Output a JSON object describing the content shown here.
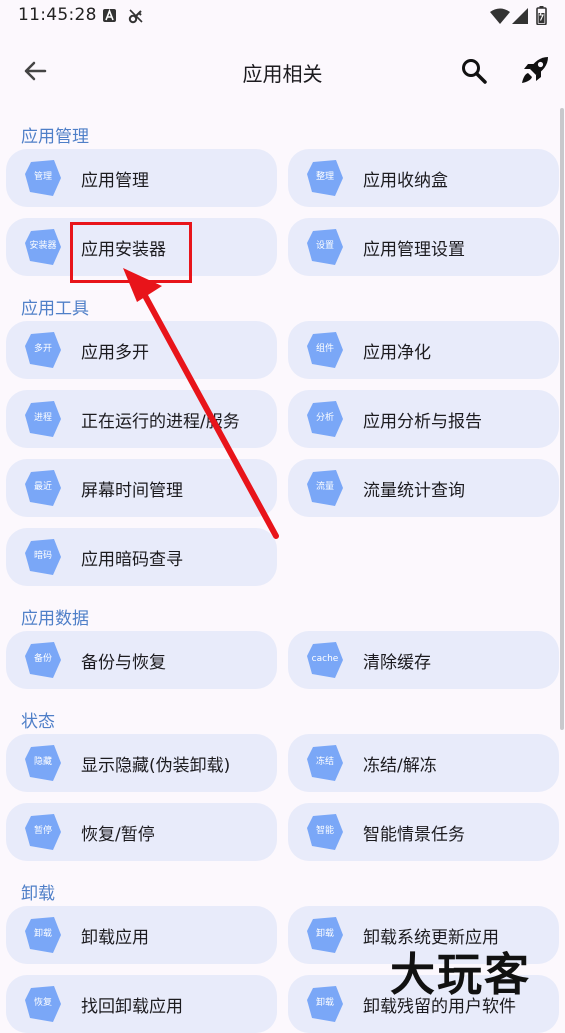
{
  "status_bar": {
    "time": "11:45:28",
    "icons": [
      "a-icon",
      "vpn-key-icon",
      "wifi-icon",
      "signal-icon",
      "battery-icon"
    ]
  },
  "app_bar": {
    "title": "应用相关",
    "icons": [
      "back-arrow-icon",
      "search-icon",
      "rocket-icon"
    ]
  },
  "sections": {
    "manage": "应用管理",
    "tools": "应用工具",
    "data": "应用数据",
    "state": "状态",
    "uninstall": "卸载"
  },
  "cards": {
    "app_manage": {
      "badge": "管理",
      "label": "应用管理"
    },
    "app_storage_box": {
      "badge": "整理",
      "label": "应用收纳盒"
    },
    "app_installer": {
      "badge": "安装器",
      "label": "应用安装器"
    },
    "app_manage_settings": {
      "badge": "设置",
      "label": "应用管理设置"
    },
    "app_multi": {
      "badge": "多开",
      "label": "应用多开"
    },
    "app_purify": {
      "badge": "组件",
      "label": "应用净化"
    },
    "running_processes": {
      "badge": "进程",
      "label": "正在运行的进程/服务"
    },
    "app_analysis": {
      "badge": "分析",
      "label": "应用分析与报告"
    },
    "screen_time": {
      "badge": "最近",
      "label": "屏幕时间管理"
    },
    "traffic_stats": {
      "badge": "流量",
      "label": "流量统计查询"
    },
    "secret_code": {
      "badge": "暗码",
      "label": "应用暗码查寻"
    },
    "backup_restore": {
      "badge": "备份",
      "label": "备份与恢复"
    },
    "clear_cache": {
      "badge": "cache",
      "label": "清除缓存"
    },
    "hide_apps": {
      "badge": "隐藏",
      "label": "显示隐藏(伪装卸载)"
    },
    "freeze": {
      "badge": "冻结",
      "label": "冻结/解冻"
    },
    "suspend": {
      "badge": "暂停",
      "label": "恢复/暂停"
    },
    "smart_scene": {
      "badge": "智能",
      "label": "智能情景任务"
    },
    "uninstall_apps": {
      "badge": "卸载",
      "label": "卸载应用"
    },
    "uninstall_system_updates": {
      "badge": "卸载",
      "label": "卸载系统更新应用"
    },
    "retrieve_uninstalled": {
      "badge": "恢复",
      "label": "找回卸载应用"
    },
    "uninstall_leftover": {
      "badge": "卸载",
      "label": "卸载残留的用户软件"
    }
  },
  "watermark": "大玩客",
  "colors": {
    "background": "#fcf8fd",
    "card": "#e8ebfa",
    "section_title": "#4f7fc8",
    "badge_blue": "#7aa7f7",
    "highlight_red": "#e8141a"
  }
}
